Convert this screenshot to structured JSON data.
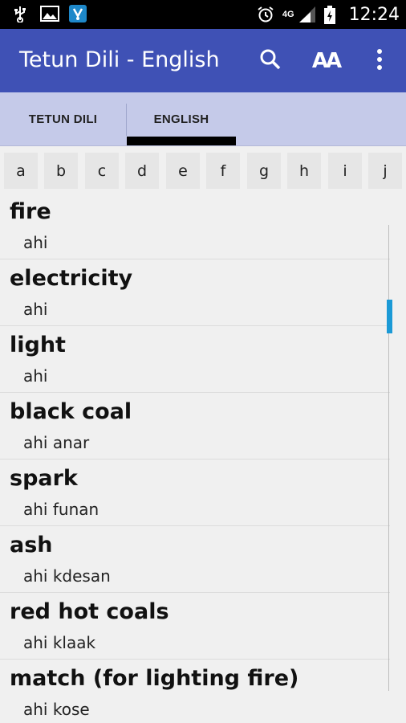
{
  "status_bar": {
    "time": "12:24",
    "network": "4G",
    "icons": [
      "usb-icon",
      "image-icon",
      "app-notification-icon",
      "alarm-icon",
      "signal-icon",
      "battery-icon"
    ]
  },
  "app_bar": {
    "title": "Tetun Dili - English",
    "actions": [
      "search-icon",
      "font-size-icon",
      "more-vert-icon"
    ],
    "font_button_label": "AA",
    "color": "#3f51b5"
  },
  "tabs": [
    {
      "label": "TETUN DILI",
      "selected": false
    },
    {
      "label": "ENGLISH",
      "selected": true
    }
  ],
  "alphabet": [
    "a",
    "b",
    "c",
    "d",
    "e",
    "f",
    "g",
    "h",
    "i",
    "j"
  ],
  "entries": [
    {
      "word": "fire",
      "translation": "ahi"
    },
    {
      "word": "electricity",
      "translation": "ahi"
    },
    {
      "word": "light",
      "translation": "ahi"
    },
    {
      "word": "black coal",
      "translation": "ahi anar"
    },
    {
      "word": "spark",
      "translation": "ahi funan"
    },
    {
      "word": "ash",
      "translation": "ahi kdesan"
    },
    {
      "word": "red hot coals",
      "translation": "ahi klaak"
    },
    {
      "word": "match (for lighting fire)",
      "translation": "ahi kose"
    }
  ]
}
